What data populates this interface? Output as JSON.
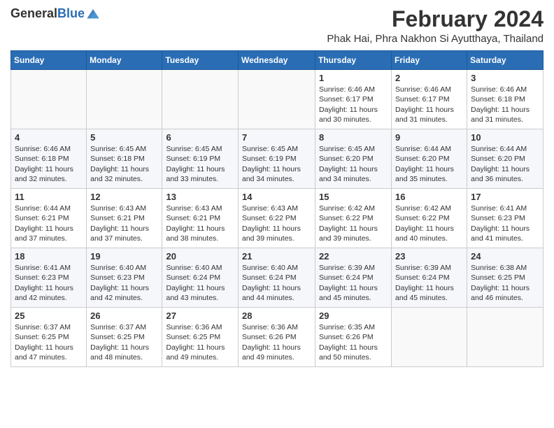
{
  "header": {
    "logo_general": "General",
    "logo_blue": "Blue",
    "main_title": "February 2024",
    "subtitle": "Phak Hai, Phra Nakhon Si Ayutthaya, Thailand"
  },
  "days_of_week": [
    "Sunday",
    "Monday",
    "Tuesday",
    "Wednesday",
    "Thursday",
    "Friday",
    "Saturday"
  ],
  "weeks": [
    [
      {
        "day": "",
        "info": ""
      },
      {
        "day": "",
        "info": ""
      },
      {
        "day": "",
        "info": ""
      },
      {
        "day": "",
        "info": ""
      },
      {
        "day": "1",
        "info": "Sunrise: 6:46 AM\nSunset: 6:17 PM\nDaylight: 11 hours and 30 minutes."
      },
      {
        "day": "2",
        "info": "Sunrise: 6:46 AM\nSunset: 6:17 PM\nDaylight: 11 hours and 31 minutes."
      },
      {
        "day": "3",
        "info": "Sunrise: 6:46 AM\nSunset: 6:18 PM\nDaylight: 11 hours and 31 minutes."
      }
    ],
    [
      {
        "day": "4",
        "info": "Sunrise: 6:46 AM\nSunset: 6:18 PM\nDaylight: 11 hours and 32 minutes."
      },
      {
        "day": "5",
        "info": "Sunrise: 6:45 AM\nSunset: 6:18 PM\nDaylight: 11 hours and 32 minutes."
      },
      {
        "day": "6",
        "info": "Sunrise: 6:45 AM\nSunset: 6:19 PM\nDaylight: 11 hours and 33 minutes."
      },
      {
        "day": "7",
        "info": "Sunrise: 6:45 AM\nSunset: 6:19 PM\nDaylight: 11 hours and 34 minutes."
      },
      {
        "day": "8",
        "info": "Sunrise: 6:45 AM\nSunset: 6:20 PM\nDaylight: 11 hours and 34 minutes."
      },
      {
        "day": "9",
        "info": "Sunrise: 6:44 AM\nSunset: 6:20 PM\nDaylight: 11 hours and 35 minutes."
      },
      {
        "day": "10",
        "info": "Sunrise: 6:44 AM\nSunset: 6:20 PM\nDaylight: 11 hours and 36 minutes."
      }
    ],
    [
      {
        "day": "11",
        "info": "Sunrise: 6:44 AM\nSunset: 6:21 PM\nDaylight: 11 hours and 37 minutes."
      },
      {
        "day": "12",
        "info": "Sunrise: 6:43 AM\nSunset: 6:21 PM\nDaylight: 11 hours and 37 minutes."
      },
      {
        "day": "13",
        "info": "Sunrise: 6:43 AM\nSunset: 6:21 PM\nDaylight: 11 hours and 38 minutes."
      },
      {
        "day": "14",
        "info": "Sunrise: 6:43 AM\nSunset: 6:22 PM\nDaylight: 11 hours and 39 minutes."
      },
      {
        "day": "15",
        "info": "Sunrise: 6:42 AM\nSunset: 6:22 PM\nDaylight: 11 hours and 39 minutes."
      },
      {
        "day": "16",
        "info": "Sunrise: 6:42 AM\nSunset: 6:22 PM\nDaylight: 11 hours and 40 minutes."
      },
      {
        "day": "17",
        "info": "Sunrise: 6:41 AM\nSunset: 6:23 PM\nDaylight: 11 hours and 41 minutes."
      }
    ],
    [
      {
        "day": "18",
        "info": "Sunrise: 6:41 AM\nSunset: 6:23 PM\nDaylight: 11 hours and 42 minutes."
      },
      {
        "day": "19",
        "info": "Sunrise: 6:40 AM\nSunset: 6:23 PM\nDaylight: 11 hours and 42 minutes."
      },
      {
        "day": "20",
        "info": "Sunrise: 6:40 AM\nSunset: 6:24 PM\nDaylight: 11 hours and 43 minutes."
      },
      {
        "day": "21",
        "info": "Sunrise: 6:40 AM\nSunset: 6:24 PM\nDaylight: 11 hours and 44 minutes."
      },
      {
        "day": "22",
        "info": "Sunrise: 6:39 AM\nSunset: 6:24 PM\nDaylight: 11 hours and 45 minutes."
      },
      {
        "day": "23",
        "info": "Sunrise: 6:39 AM\nSunset: 6:24 PM\nDaylight: 11 hours and 45 minutes."
      },
      {
        "day": "24",
        "info": "Sunrise: 6:38 AM\nSunset: 6:25 PM\nDaylight: 11 hours and 46 minutes."
      }
    ],
    [
      {
        "day": "25",
        "info": "Sunrise: 6:37 AM\nSunset: 6:25 PM\nDaylight: 11 hours and 47 minutes."
      },
      {
        "day": "26",
        "info": "Sunrise: 6:37 AM\nSunset: 6:25 PM\nDaylight: 11 hours and 48 minutes."
      },
      {
        "day": "27",
        "info": "Sunrise: 6:36 AM\nSunset: 6:25 PM\nDaylight: 11 hours and 49 minutes."
      },
      {
        "day": "28",
        "info": "Sunrise: 6:36 AM\nSunset: 6:26 PM\nDaylight: 11 hours and 49 minutes."
      },
      {
        "day": "29",
        "info": "Sunrise: 6:35 AM\nSunset: 6:26 PM\nDaylight: 11 hours and 50 minutes."
      },
      {
        "day": "",
        "info": ""
      },
      {
        "day": "",
        "info": ""
      }
    ]
  ]
}
